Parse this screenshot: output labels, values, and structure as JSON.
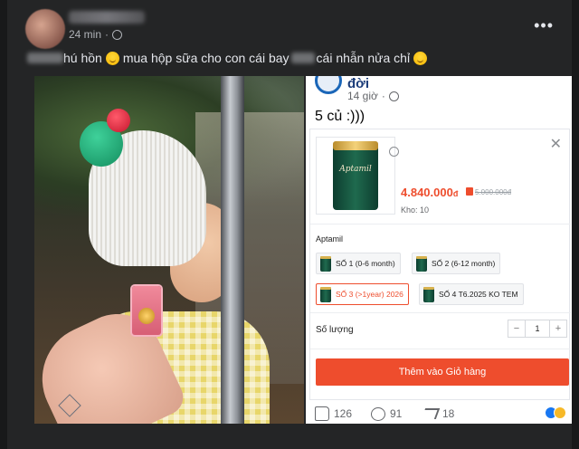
{
  "post": {
    "time": "24 min",
    "caption": {
      "text1": "hú hồn",
      "text2": "mua hộp sữa cho con cái bay",
      "text3": "cái nhẫn nửa chỉ"
    }
  },
  "embedded": {
    "page_name": "đời",
    "time": "14 giờ",
    "text": "5 củ :)))",
    "product": {
      "can_label": "Aptamil",
      "price": "4.840.000",
      "currency": "đ",
      "old_price": "5.000.000đ",
      "stock": "Kho: 10",
      "brand": "Aptamil",
      "options": [
        "SỐ 1 (0-6 month)",
        "SỐ 2 (6-12 month)",
        "SỐ 3 (>1year) 2026",
        "SỐ 4 T6.2025 KO TEM"
      ],
      "qty_label": "Số lượng",
      "qty_minus": "−",
      "qty_value": "1",
      "qty_plus": "+",
      "add_to_cart": "Thêm vào Giỏ hàng",
      "accent": "#ee4d2d"
    },
    "stats": {
      "likes": "126",
      "comments": "91",
      "shares": "18"
    }
  }
}
